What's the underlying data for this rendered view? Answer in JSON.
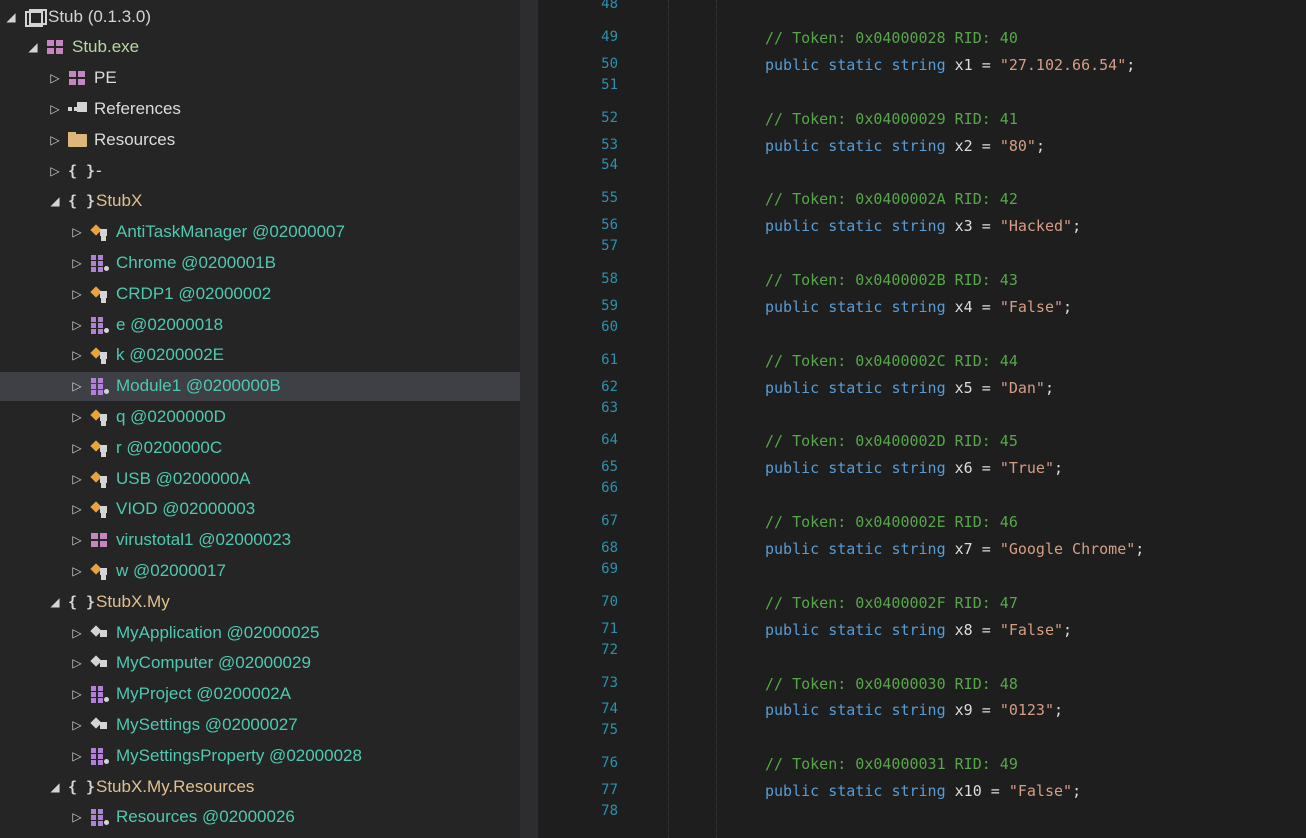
{
  "tree": [
    {
      "indent": 0,
      "exp": "◢",
      "icon": "asm",
      "label": "Stub (0.1.3.0)",
      "cls": "lbl-asm",
      "icon_name": "assembly-icon"
    },
    {
      "indent": 1,
      "exp": "◢",
      "icon": "mod",
      "label": "Stub.exe",
      "cls": "lbl-mod",
      "icon_name": "module-icon"
    },
    {
      "indent": 2,
      "exp": "▷",
      "icon": "mod",
      "label": "PE",
      "cls": "gray",
      "icon_name": "pe-icon"
    },
    {
      "indent": 2,
      "exp": "▷",
      "icon": "refs",
      "label": "References",
      "cls": "gray",
      "icon_name": "references-icon"
    },
    {
      "indent": 2,
      "exp": "▷",
      "icon": "folder",
      "label": "Resources",
      "cls": "gray",
      "icon_name": "folder-icon"
    },
    {
      "indent": 2,
      "exp": "▷",
      "icon": "ns",
      "label": "-",
      "cls": "gray",
      "icon_name": "namespace-icon"
    },
    {
      "indent": 2,
      "exp": "◢",
      "icon": "ns",
      "label": "StubX",
      "cls": "lbl-y",
      "icon_name": "namespace-icon"
    },
    {
      "indent": 3,
      "exp": "▷",
      "icon": "class",
      "label": "AntiTaskManager @02000007",
      "cls": "lbl-t",
      "icon_name": "class-icon"
    },
    {
      "indent": 3,
      "exp": "▷",
      "icon": "modl",
      "label": "Chrome @0200001B",
      "cls": "lbl-t",
      "icon_name": "vb-module-icon"
    },
    {
      "indent": 3,
      "exp": "▷",
      "icon": "class",
      "label": "CRDP1 @02000002",
      "cls": "lbl-t",
      "icon_name": "class-icon"
    },
    {
      "indent": 3,
      "exp": "▷",
      "icon": "modl",
      "label": "e @02000018",
      "cls": "lbl-t",
      "icon_name": "vb-module-icon"
    },
    {
      "indent": 3,
      "exp": "▷",
      "icon": "class",
      "label": "k @0200002E",
      "cls": "lbl-t",
      "icon_name": "class-icon"
    },
    {
      "indent": 3,
      "exp": "▷",
      "icon": "modl",
      "label": "Module1 @0200000B",
      "cls": "lbl-t",
      "icon_name": "vb-module-icon",
      "selected": true
    },
    {
      "indent": 3,
      "exp": "▷",
      "icon": "class",
      "label": "q @0200000D",
      "cls": "lbl-t",
      "icon_name": "class-icon"
    },
    {
      "indent": 3,
      "exp": "▷",
      "icon": "class",
      "label": "r @0200000C",
      "cls": "lbl-t",
      "icon_name": "class-icon"
    },
    {
      "indent": 3,
      "exp": "▷",
      "icon": "class",
      "label": "USB @0200000A",
      "cls": "lbl-t",
      "icon_name": "class-icon"
    },
    {
      "indent": 3,
      "exp": "▷",
      "icon": "class",
      "label": "VIOD @02000003",
      "cls": "lbl-t",
      "icon_name": "class-icon"
    },
    {
      "indent": 3,
      "exp": "▷",
      "icon": "mod",
      "label": "virustotal1 @02000023",
      "cls": "lbl-t",
      "icon_name": "module-icon"
    },
    {
      "indent": 3,
      "exp": "▷",
      "icon": "class",
      "label": "w @02000017",
      "cls": "lbl-t",
      "icon_name": "class-icon"
    },
    {
      "indent": 2,
      "exp": "◢",
      "icon": "ns",
      "label": "StubX.My",
      "cls": "lbl-y",
      "icon_name": "namespace-icon"
    },
    {
      "indent": 3,
      "exp": "▷",
      "icon": "mclass",
      "label": "MyApplication @02000025",
      "cls": "lbl-t",
      "icon_name": "sealed-class-icon"
    },
    {
      "indent": 3,
      "exp": "▷",
      "icon": "mclass",
      "label": "MyComputer @02000029",
      "cls": "lbl-t",
      "icon_name": "sealed-class-icon"
    },
    {
      "indent": 3,
      "exp": "▷",
      "icon": "modl",
      "label": "MyProject @0200002A",
      "cls": "lbl-t",
      "icon_name": "vb-module-icon"
    },
    {
      "indent": 3,
      "exp": "▷",
      "icon": "mclass",
      "label": "MySettings @02000027",
      "cls": "lbl-t",
      "icon_name": "sealed-class-icon"
    },
    {
      "indent": 3,
      "exp": "▷",
      "icon": "modl",
      "label": "MySettingsProperty @02000028",
      "cls": "lbl-t",
      "icon_name": "vb-module-icon"
    },
    {
      "indent": 2,
      "exp": "◢",
      "icon": "ns",
      "label": "StubX.My.Resources",
      "cls": "lbl-y",
      "icon_name": "namespace-icon"
    },
    {
      "indent": 3,
      "exp": "▷",
      "icon": "modl",
      "label": "Resources @02000026",
      "cls": "lbl-t",
      "icon_name": "vb-module-icon"
    }
  ],
  "code": [
    {
      "n": "48",
      "type": "blank"
    },
    {
      "n": "49",
      "type": "comment",
      "text": "// Token: 0x04000028 RID: 40"
    },
    {
      "n": "50",
      "type": "decl",
      "name": "x1",
      "value": "\"27.102.66.54\""
    },
    {
      "n": "51",
      "type": "blank"
    },
    {
      "n": "52",
      "type": "comment",
      "text": "// Token: 0x04000029 RID: 41"
    },
    {
      "n": "53",
      "type": "decl",
      "name": "x2",
      "value": "\"80\""
    },
    {
      "n": "54",
      "type": "blank"
    },
    {
      "n": "55",
      "type": "comment",
      "text": "// Token: 0x0400002A RID: 42"
    },
    {
      "n": "56",
      "type": "decl",
      "name": "x3",
      "value": "\"Hacked\""
    },
    {
      "n": "57",
      "type": "blank"
    },
    {
      "n": "58",
      "type": "comment",
      "text": "// Token: 0x0400002B RID: 43"
    },
    {
      "n": "59",
      "type": "decl",
      "name": "x4",
      "value": "\"False\""
    },
    {
      "n": "60",
      "type": "blank"
    },
    {
      "n": "61",
      "type": "comment",
      "text": "// Token: 0x0400002C RID: 44"
    },
    {
      "n": "62",
      "type": "decl",
      "name": "x5",
      "value": "\"Dan\""
    },
    {
      "n": "63",
      "type": "blank"
    },
    {
      "n": "64",
      "type": "comment",
      "text": "// Token: 0x0400002D RID: 45"
    },
    {
      "n": "65",
      "type": "decl",
      "name": "x6",
      "value": "\"True\""
    },
    {
      "n": "66",
      "type": "blank"
    },
    {
      "n": "67",
      "type": "comment",
      "text": "// Token: 0x0400002E RID: 46"
    },
    {
      "n": "68",
      "type": "decl",
      "name": "x7",
      "value": "\"Google Chrome\""
    },
    {
      "n": "69",
      "type": "blank"
    },
    {
      "n": "70",
      "type": "comment",
      "text": "// Token: 0x0400002F RID: 47"
    },
    {
      "n": "71",
      "type": "decl",
      "name": "x8",
      "value": "\"False\""
    },
    {
      "n": "72",
      "type": "blank"
    },
    {
      "n": "73",
      "type": "comment",
      "text": "// Token: 0x04000030 RID: 48"
    },
    {
      "n": "74",
      "type": "decl",
      "name": "x9",
      "value": "\"0123\""
    },
    {
      "n": "75",
      "type": "blank"
    },
    {
      "n": "76",
      "type": "comment",
      "text": "// Token: 0x04000031 RID: 49"
    },
    {
      "n": "77",
      "type": "decl",
      "name": "x10",
      "value": "\"False\""
    },
    {
      "n": "78",
      "type": "blank"
    }
  ],
  "syntax": {
    "kw_public": "public",
    "kw_static": "static",
    "kw_string": "string",
    "eq": "=",
    "semi": ";"
  },
  "colors": {
    "comment": "#57a64a",
    "keyword": "#569cd6",
    "string": "#d69d85",
    "line_number": "#2b91af",
    "namespace": "#e2c08d",
    "type": "#4ec9b0"
  }
}
